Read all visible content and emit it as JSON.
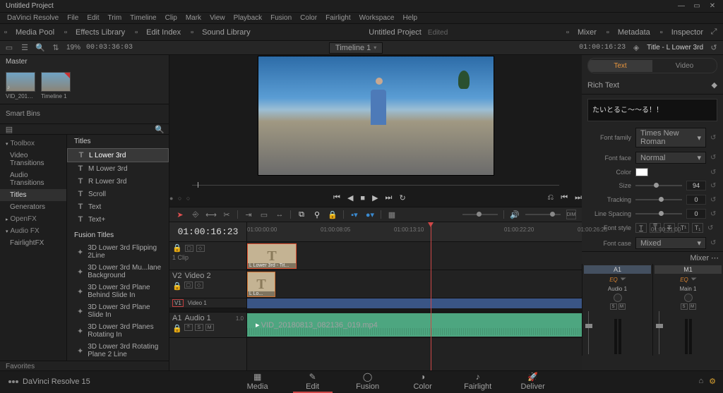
{
  "window": {
    "title": "Untitled Project"
  },
  "app_menu": [
    "DaVinci Resolve",
    "File",
    "Edit",
    "Trim",
    "Timeline",
    "Clip",
    "Mark",
    "View",
    "Playback",
    "Fusion",
    "Color",
    "Fairlight",
    "Workspace",
    "Help"
  ],
  "workspace_tabs": {
    "left": [
      {
        "icon": "media-pool",
        "label": "Media Pool"
      },
      {
        "icon": "fx",
        "label": "Effects Library"
      },
      {
        "icon": "index",
        "label": "Edit Index"
      },
      {
        "icon": "sound",
        "label": "Sound Library"
      }
    ],
    "center": {
      "title": "Untitled Project",
      "sub": "Edited"
    },
    "right": [
      {
        "icon": "mixer",
        "label": "Mixer"
      },
      {
        "icon": "meta",
        "label": "Metadata"
      },
      {
        "icon": "inspector",
        "label": "Inspector"
      }
    ]
  },
  "toolbar": {
    "zoom_pct": "19%",
    "src_tc": "00:03:36:03",
    "timeline_dd": "Timeline 1",
    "rec_tc": "01:00:16:23",
    "inspector_title": "Title - L Lower 3rd"
  },
  "mediapool": {
    "bin": "Master",
    "clips": [
      {
        "name": "VID_20180813_08213...",
        "type": "video"
      },
      {
        "name": "Timeline 1",
        "type": "timeline"
      }
    ],
    "smartbins": "Smart Bins"
  },
  "effects": {
    "sidebar": [
      {
        "label": "Toolbox",
        "type": "hdr"
      },
      {
        "label": "Video Transitions"
      },
      {
        "label": "Audio Transitions"
      },
      {
        "label": "Titles",
        "selected": true
      },
      {
        "label": "Generators"
      },
      {
        "label": "OpenFX",
        "type": "hdr_collapsed"
      },
      {
        "label": "Audio FX",
        "type": "hdr"
      },
      {
        "label": "FairlightFX"
      }
    ],
    "titles_hdr": "Titles",
    "titles": [
      {
        "name": "L Lower 3rd",
        "selected": true
      },
      {
        "name": "M Lower 3rd"
      },
      {
        "name": "R Lower 3rd"
      },
      {
        "name": "Scroll"
      },
      {
        "name": "Text"
      },
      {
        "name": "Text+"
      }
    ],
    "fusion_hdr": "Fusion Titles",
    "fusion": [
      "3D Lower 3rd Flipping 2Line",
      "3D Lower 3rd Mu...lane Background",
      "3D Lower 3rd Plane Behind Slide In",
      "3D Lower 3rd Plane Slide In",
      "3D Lower 3rd Planes Rotating In",
      "3D Lower 3rd Rotating Plane 2 Line"
    ],
    "favorites": "Favorites"
  },
  "timeline": {
    "tc": "01:00:16:23",
    "ruler": [
      "01:00:00:00",
      "",
      "01:00:08:05",
      "",
      "01:00:13:10",
      "",
      "",
      "01:00:22:20",
      "",
      "01:00:26:25",
      "",
      "01:00:31:00"
    ],
    "v2": {
      "id": "V2",
      "name": "Video 2",
      "clip": "L Lower 3rd - Tit...",
      "clip2": "L Lo..."
    },
    "v1": {
      "id": "V1",
      "name": "Video 1"
    },
    "a1": {
      "id": "A1",
      "name": "Audio 1",
      "lvl": "1.0",
      "file": "VID_20180813_082136_019.mp4"
    }
  },
  "inspector": {
    "tabs": [
      "Text",
      "Video"
    ],
    "active_tab": "Text",
    "section": "Rich Text",
    "rich_text": "たいとるこ～～る！！",
    "font_family": {
      "label": "Font family",
      "value": "Times New Roman"
    },
    "font_face": {
      "label": "Font face",
      "value": "Normal"
    },
    "color": {
      "label": "Color",
      "value": "#FFFFFF"
    },
    "size": {
      "label": "Size",
      "value": "94"
    },
    "tracking": {
      "label": "Tracking",
      "value": "0"
    },
    "line_spacing": {
      "label": "Line Spacing",
      "value": "0"
    },
    "font_style": {
      "label": "Font style"
    },
    "font_case": {
      "label": "Font case",
      "value": "Mixed"
    }
  },
  "mixer": {
    "hdr": "Mixer",
    "channels": [
      {
        "id": "A1",
        "eq": "EQ",
        "label": "Audio 1"
      },
      {
        "id": "M1",
        "eq": "EQ",
        "label": "Main 1"
      }
    ]
  },
  "pages": {
    "logo": "DaVinci Resolve 15",
    "tabs": [
      {
        "id": "media",
        "label": "Media",
        "icon": "▦"
      },
      {
        "id": "edit",
        "label": "Edit",
        "icon": "✎",
        "active": true
      },
      {
        "id": "fusion",
        "label": "Fusion",
        "icon": "◯"
      },
      {
        "id": "color",
        "label": "Color",
        "icon": "◑"
      },
      {
        "id": "fairlight",
        "label": "Fairlight",
        "icon": "♪"
      },
      {
        "id": "deliver",
        "label": "Deliver",
        "icon": "🚀"
      }
    ]
  }
}
